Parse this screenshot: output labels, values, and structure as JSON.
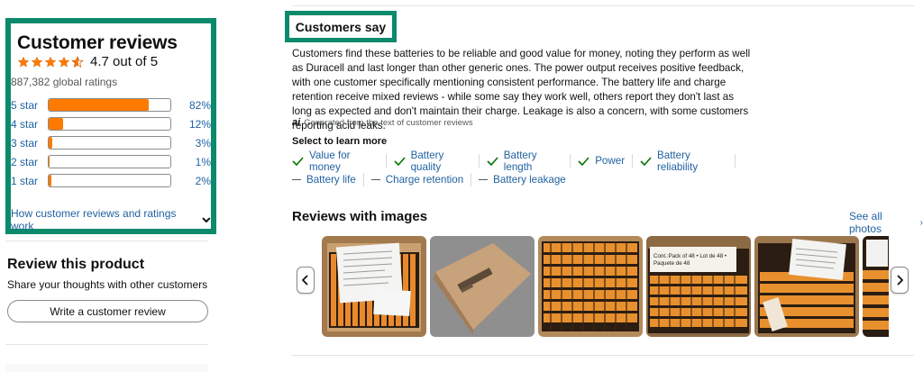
{
  "customer_reviews": {
    "title": "Customer reviews",
    "rating_text": "4.7 out of 5",
    "rating": 4.7,
    "global_ratings": "887,382 global ratings",
    "histogram": [
      {
        "label": "5 star",
        "pct": "82%",
        "value": 82
      },
      {
        "label": "4 star",
        "pct": "12%",
        "value": 12
      },
      {
        "label": "3 star",
        "pct": "3%",
        "value": 3
      },
      {
        "label": "2 star",
        "pct": "1%",
        "value": 1
      },
      {
        "label": "1 star",
        "pct": "2%",
        "value": 2
      }
    ],
    "how_link": "How customer reviews and ratings work"
  },
  "review_product": {
    "title": "Review this product",
    "subtitle": "Share your thoughts with other customers",
    "button": "Write a customer review"
  },
  "customers_say": {
    "heading": "Customers say",
    "summary": "Customers find these batteries to be reliable and good value for money, noting they perform as well as Duracell and last longer than other generic ones. The power output receives positive feedback, with one customer specifically mentioning consistent performance. The battery life and charge retention receive mixed reviews - while some say they work well, others report they don't last as long as expected and don't maintain their charge. Leakage is also a concern, with some customers reporting acid leaks.",
    "ai_badge": "ai",
    "ai_note": "Generated from the text of customer reviews",
    "select_label": "Select to learn more",
    "positive_aspects": [
      "Value for money",
      "Battery quality",
      "Battery length",
      "Power",
      "Battery reliability"
    ],
    "mixed_aspects": [
      "Battery life",
      "Charge retention",
      "Battery leakage"
    ]
  },
  "reviews_with_images": {
    "title": "Reviews with images",
    "see_all": "See all photos",
    "thumb4_caption_line1": "Cont.:Pack of 48 • Lot de 48 •",
    "thumb4_caption_line2": "Paquete de 48"
  },
  "colors": {
    "link": "#2162a1",
    "star": "#ff7a00",
    "bar_fill": "#ff7a00",
    "highlight_border": "#0b8a6c",
    "check": "#007600"
  }
}
